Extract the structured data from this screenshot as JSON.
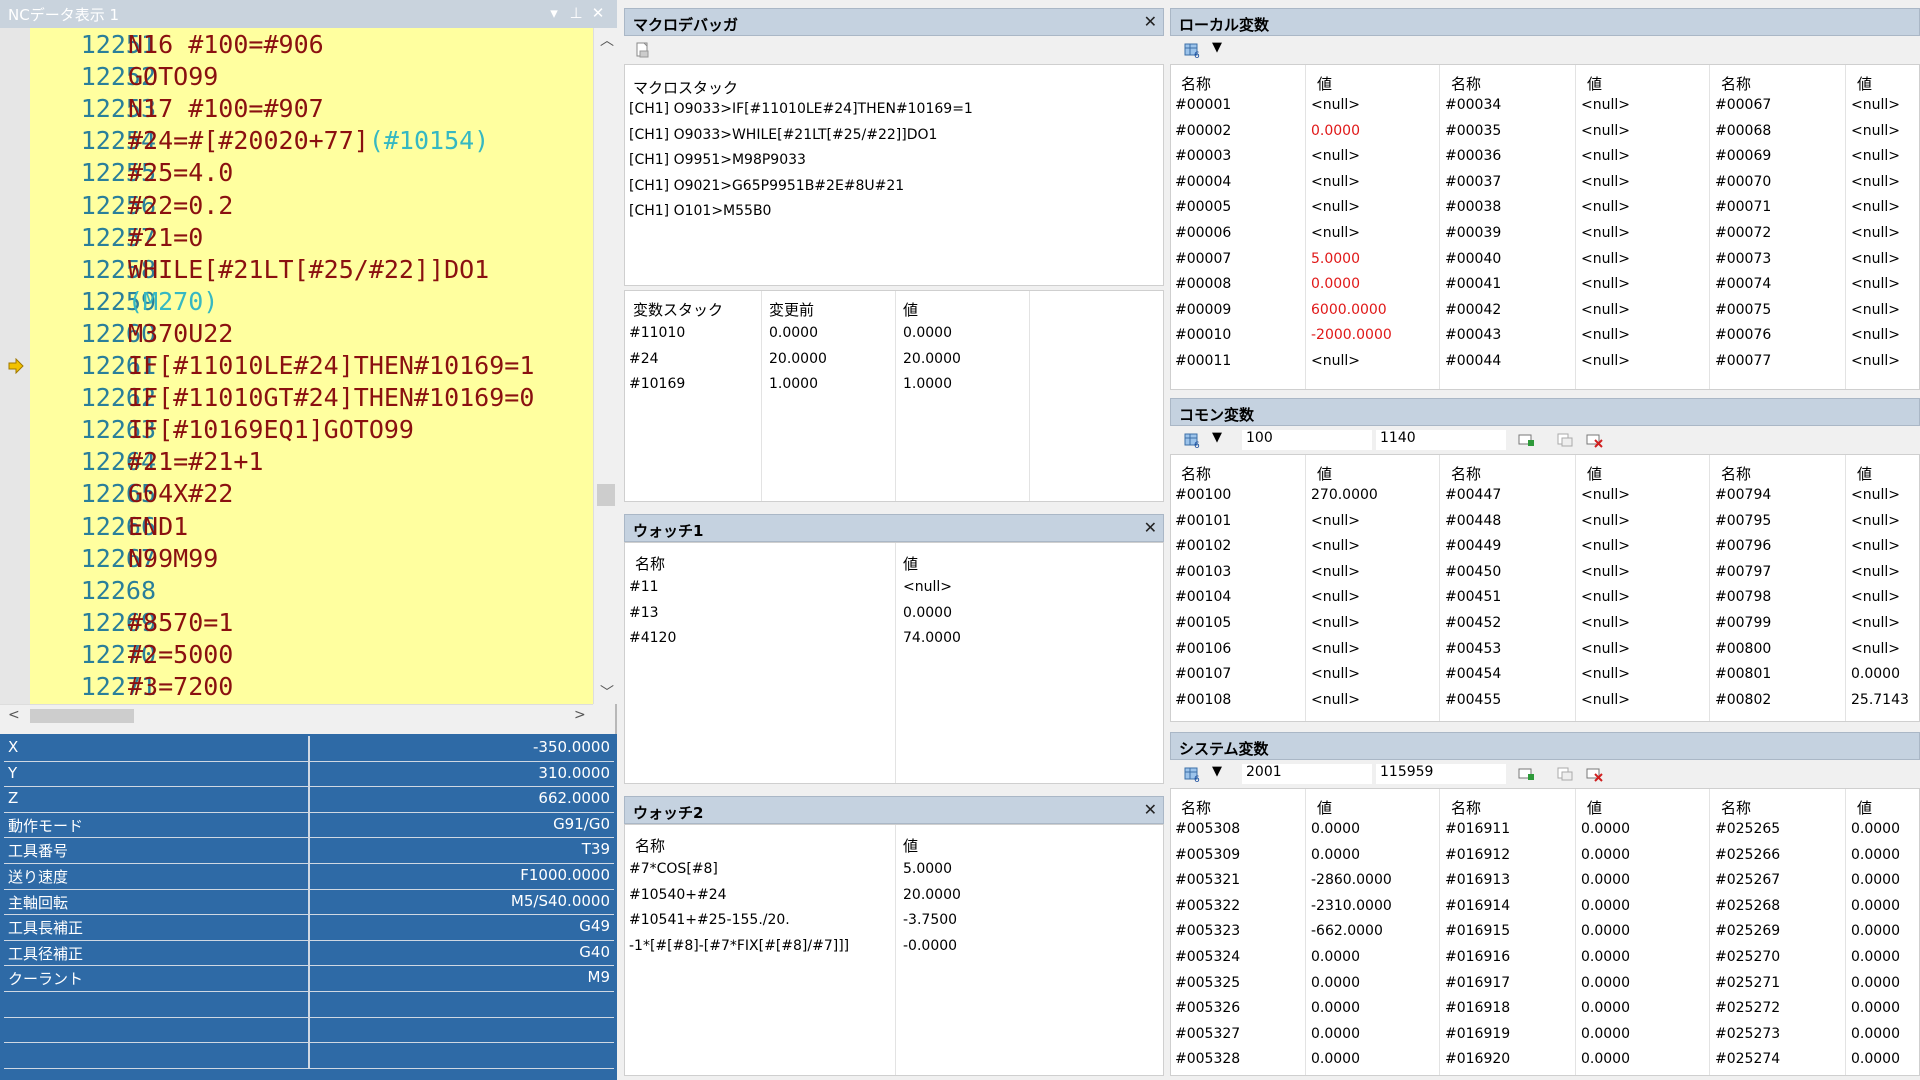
{
  "nc": {
    "title": "NCデータ表示 1",
    "lines": [
      {
        "no": "12251",
        "code": "N16 #100=#906",
        "comment": ""
      },
      {
        "no": "12252",
        "code": "GOTO99",
        "comment": ""
      },
      {
        "no": "12253",
        "code": "N17 #100=#907",
        "comment": ""
      },
      {
        "no": "12254",
        "code": "#24=#[#20020+77]",
        "comment": "(#10154)"
      },
      {
        "no": "12255",
        "code": "#25=4.0",
        "comment": ""
      },
      {
        "no": "12256",
        "code": "#22=0.2",
        "comment": ""
      },
      {
        "no": "12257",
        "code": "#21=0",
        "comment": ""
      },
      {
        "no": "12258",
        "code": "WHILE[#21LT[#25/#22]]DO1",
        "comment": ""
      },
      {
        "no": "12259",
        "code": "",
        "comment": "(M270)"
      },
      {
        "no": "12260",
        "code": "M370U22",
        "comment": ""
      },
      {
        "no": "12261",
        "code": "IF[#11010LE#24]THEN#10169=1",
        "comment": ""
      },
      {
        "no": "12262",
        "code": "IF[#11010GT#24]THEN#10169=0",
        "comment": ""
      },
      {
        "no": "12263",
        "code": "IF[#10169EQ1]GOTO99",
        "comment": ""
      },
      {
        "no": "12264",
        "code": "#21=#21+1",
        "comment": ""
      },
      {
        "no": "12265",
        "code": "G04X#22",
        "comment": ""
      },
      {
        "no": "12266",
        "code": "END1",
        "comment": ""
      },
      {
        "no": "12267",
        "code": "N99M99",
        "comment": ""
      },
      {
        "no": "12268",
        "code": "",
        "comment": ""
      },
      {
        "no": "12269",
        "code": "#8570=1",
        "comment": ""
      },
      {
        "no": "12270",
        "code": "#2=5000",
        "comment": ""
      },
      {
        "no": "12271",
        "code": "#3=7200",
        "comment": ""
      }
    ],
    "current_line_index": 10,
    "status": [
      {
        "k": "X",
        "v": "-350.0000"
      },
      {
        "k": "Y",
        "v": "310.0000"
      },
      {
        "k": "Z",
        "v": "662.0000"
      },
      {
        "k": "動作モード",
        "v": "G91/G0"
      },
      {
        "k": "工具番号",
        "v": "T39"
      },
      {
        "k": "送り速度",
        "v": "F1000.0000"
      },
      {
        "k": "主軸回転",
        "v": "M5/S40.0000"
      },
      {
        "k": "工具長補正",
        "v": "G49"
      },
      {
        "k": "工具径補正",
        "v": "G40"
      },
      {
        "k": "クーラント",
        "v": "M9"
      },
      {
        "k": "",
        "v": ""
      },
      {
        "k": "",
        "v": ""
      },
      {
        "k": "",
        "v": ""
      }
    ]
  },
  "debugger": {
    "title": "マクロデバッガ",
    "stack_label": "マクロスタック",
    "stack": [
      "[CH1] O9033>IF[#11010LE#24]THEN#10169=1",
      "[CH1] O9033>WHILE[#21LT[#25/#22]]DO1",
      "[CH1] O9951>M98P9033",
      "[CH1] O9021>G65P9951B#2E#8U#21",
      "[CH1] O101>M55B0"
    ],
    "var_headers": [
      "変数スタック",
      "変更前",
      "値"
    ],
    "vars": [
      [
        "#11010",
        "0.0000",
        "0.0000"
      ],
      [
        "#24",
        "20.0000",
        "20.0000"
      ],
      [
        "#10169",
        "1.0000",
        "1.0000"
      ]
    ]
  },
  "watch1": {
    "title": "ウォッチ1",
    "headers": [
      "名称",
      "値"
    ],
    "rows": [
      [
        "#11",
        "<null>"
      ],
      [
        "#13",
        "0.0000"
      ],
      [
        "#4120",
        "74.0000"
      ]
    ]
  },
  "watch2": {
    "title": "ウォッチ2",
    "headers": [
      "名称",
      "値"
    ],
    "rows": [
      [
        "#7*COS[#8]",
        "5.0000"
      ],
      [
        "#10540+#24",
        "20.0000"
      ],
      [
        "#10541+#25-155./20.",
        "-3.7500"
      ],
      [
        "-1*[#[#8]-[#7*FIX[#[#8]/#7]]]",
        "-0.0000"
      ]
    ]
  },
  "local": {
    "title": "ローカル変数",
    "headers": [
      "名称",
      "値",
      "名称",
      "値",
      "名称",
      "値"
    ],
    "rows": [
      [
        "#00001",
        "<null>",
        "#00034",
        "<null>",
        "#00067",
        "<null>"
      ],
      [
        "#00002",
        "0.0000",
        "#00035",
        "<null>",
        "#00068",
        "<null>"
      ],
      [
        "#00003",
        "<null>",
        "#00036",
        "<null>",
        "#00069",
        "<null>"
      ],
      [
        "#00004",
        "<null>",
        "#00037",
        "<null>",
        "#00070",
        "<null>"
      ],
      [
        "#00005",
        "<null>",
        "#00038",
        "<null>",
        "#00071",
        "<null>"
      ],
      [
        "#00006",
        "<null>",
        "#00039",
        "<null>",
        "#00072",
        "<null>"
      ],
      [
        "#00007",
        "5.0000",
        "#00040",
        "<null>",
        "#00073",
        "<null>"
      ],
      [
        "#00008",
        "0.0000",
        "#00041",
        "<null>",
        "#00074",
        "<null>"
      ],
      [
        "#00009",
        "6000.0000",
        "#00042",
        "<null>",
        "#00075",
        "<null>"
      ],
      [
        "#00010",
        "-2000.0000",
        "#00043",
        "<null>",
        "#00076",
        "<null>"
      ],
      [
        "#00011",
        "<null>",
        "#00044",
        "<null>",
        "#00077",
        "<null>"
      ]
    ],
    "red_rows": [
      1,
      6,
      7,
      8,
      9
    ]
  },
  "common": {
    "title": "コモン変数",
    "range_from": "100",
    "range_to": "1140",
    "headers": [
      "名称",
      "値",
      "名称",
      "値",
      "名称",
      "値"
    ],
    "rows": [
      [
        "#00100",
        "270.0000",
        "#00447",
        "<null>",
        "#00794",
        "<null>"
      ],
      [
        "#00101",
        "<null>",
        "#00448",
        "<null>",
        "#00795",
        "<null>"
      ],
      [
        "#00102",
        "<null>",
        "#00449",
        "<null>",
        "#00796",
        "<null>"
      ],
      [
        "#00103",
        "<null>",
        "#00450",
        "<null>",
        "#00797",
        "<null>"
      ],
      [
        "#00104",
        "<null>",
        "#00451",
        "<null>",
        "#00798",
        "<null>"
      ],
      [
        "#00105",
        "<null>",
        "#00452",
        "<null>",
        "#00799",
        "<null>"
      ],
      [
        "#00106",
        "<null>",
        "#00453",
        "<null>",
        "#00800",
        "<null>"
      ],
      [
        "#00107",
        "<null>",
        "#00454",
        "<null>",
        "#00801",
        "0.0000"
      ],
      [
        "#00108",
        "<null>",
        "#00455",
        "<null>",
        "#00802",
        "25.7143"
      ]
    ]
  },
  "system": {
    "title": "システム変数",
    "range_from": "2001",
    "range_to": "115959",
    "headers": [
      "名称",
      "値",
      "名称",
      "値",
      "名称",
      "値"
    ],
    "rows": [
      [
        "#005308",
        "0.0000",
        "#016911",
        "0.0000",
        "#025265",
        "0.0000"
      ],
      [
        "#005309",
        "0.0000",
        "#016912",
        "0.0000",
        "#025266",
        "0.0000"
      ],
      [
        "#005321",
        "-2860.0000",
        "#016913",
        "0.0000",
        "#025267",
        "0.0000"
      ],
      [
        "#005322",
        "-2310.0000",
        "#016914",
        "0.0000",
        "#025268",
        "0.0000"
      ],
      [
        "#005323",
        "-662.0000",
        "#016915",
        "0.0000",
        "#025269",
        "0.0000"
      ],
      [
        "#005324",
        "0.0000",
        "#016916",
        "0.0000",
        "#025270",
        "0.0000"
      ],
      [
        "#005325",
        "0.0000",
        "#016917",
        "0.0000",
        "#025271",
        "0.0000"
      ],
      [
        "#005326",
        "0.0000",
        "#016918",
        "0.0000",
        "#025272",
        "0.0000"
      ],
      [
        "#005327",
        "0.0000",
        "#016919",
        "0.0000",
        "#025273",
        "0.0000"
      ],
      [
        "#005328",
        "0.0000",
        "#016920",
        "0.0000",
        "#025274",
        "0.0000"
      ]
    ]
  },
  "colors": {
    "code_bg": "#ffff9f",
    "code_text": "#8a1010",
    "line_no": "#2a7f9a",
    "comment": "#36b8c2",
    "status_bg": "#2e6aa6",
    "changed_value": "#e01818",
    "panel_header": "#c5d2e0"
  },
  "icons": {
    "current_line": "arrow-right-icon",
    "toolbar": "table-icon"
  }
}
